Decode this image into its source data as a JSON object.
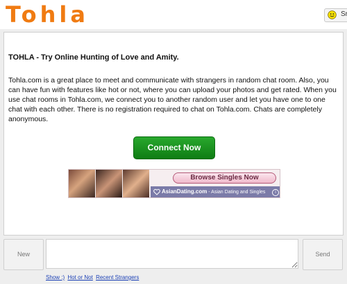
{
  "header": {
    "logo": "Tohla",
    "smiley_label": "Sr"
  },
  "main": {
    "title": "TOHLA - Try Online Hunting of Love and Amity.",
    "description": "Tohla.com is a great place to meet and communicate with strangers in random chat room. Also, you can have fun with features like hot or not, where you can upload your photos and get rated. When you use chat rooms in Tohla.com, we connect you to another random user and let you have one to one chat with each other. There is no registration required to chat on Tohla.com. Chats are completely anonymous.",
    "connect_label": "Connect Now"
  },
  "ad": {
    "browse_label": "Browse Singles Now",
    "brand": "AsianDating.com",
    "tagline": "- Asian Dating and Singles"
  },
  "chat": {
    "new_label": "New",
    "send_label": "Send"
  },
  "links": {
    "show": "Show :)",
    "hot_or_not": "Hot or Not",
    "recent": "Recent Strangers"
  },
  "colors": {
    "logo": "#f07b12",
    "connect": "#1a9a1f",
    "link": "#1a3fb5"
  }
}
